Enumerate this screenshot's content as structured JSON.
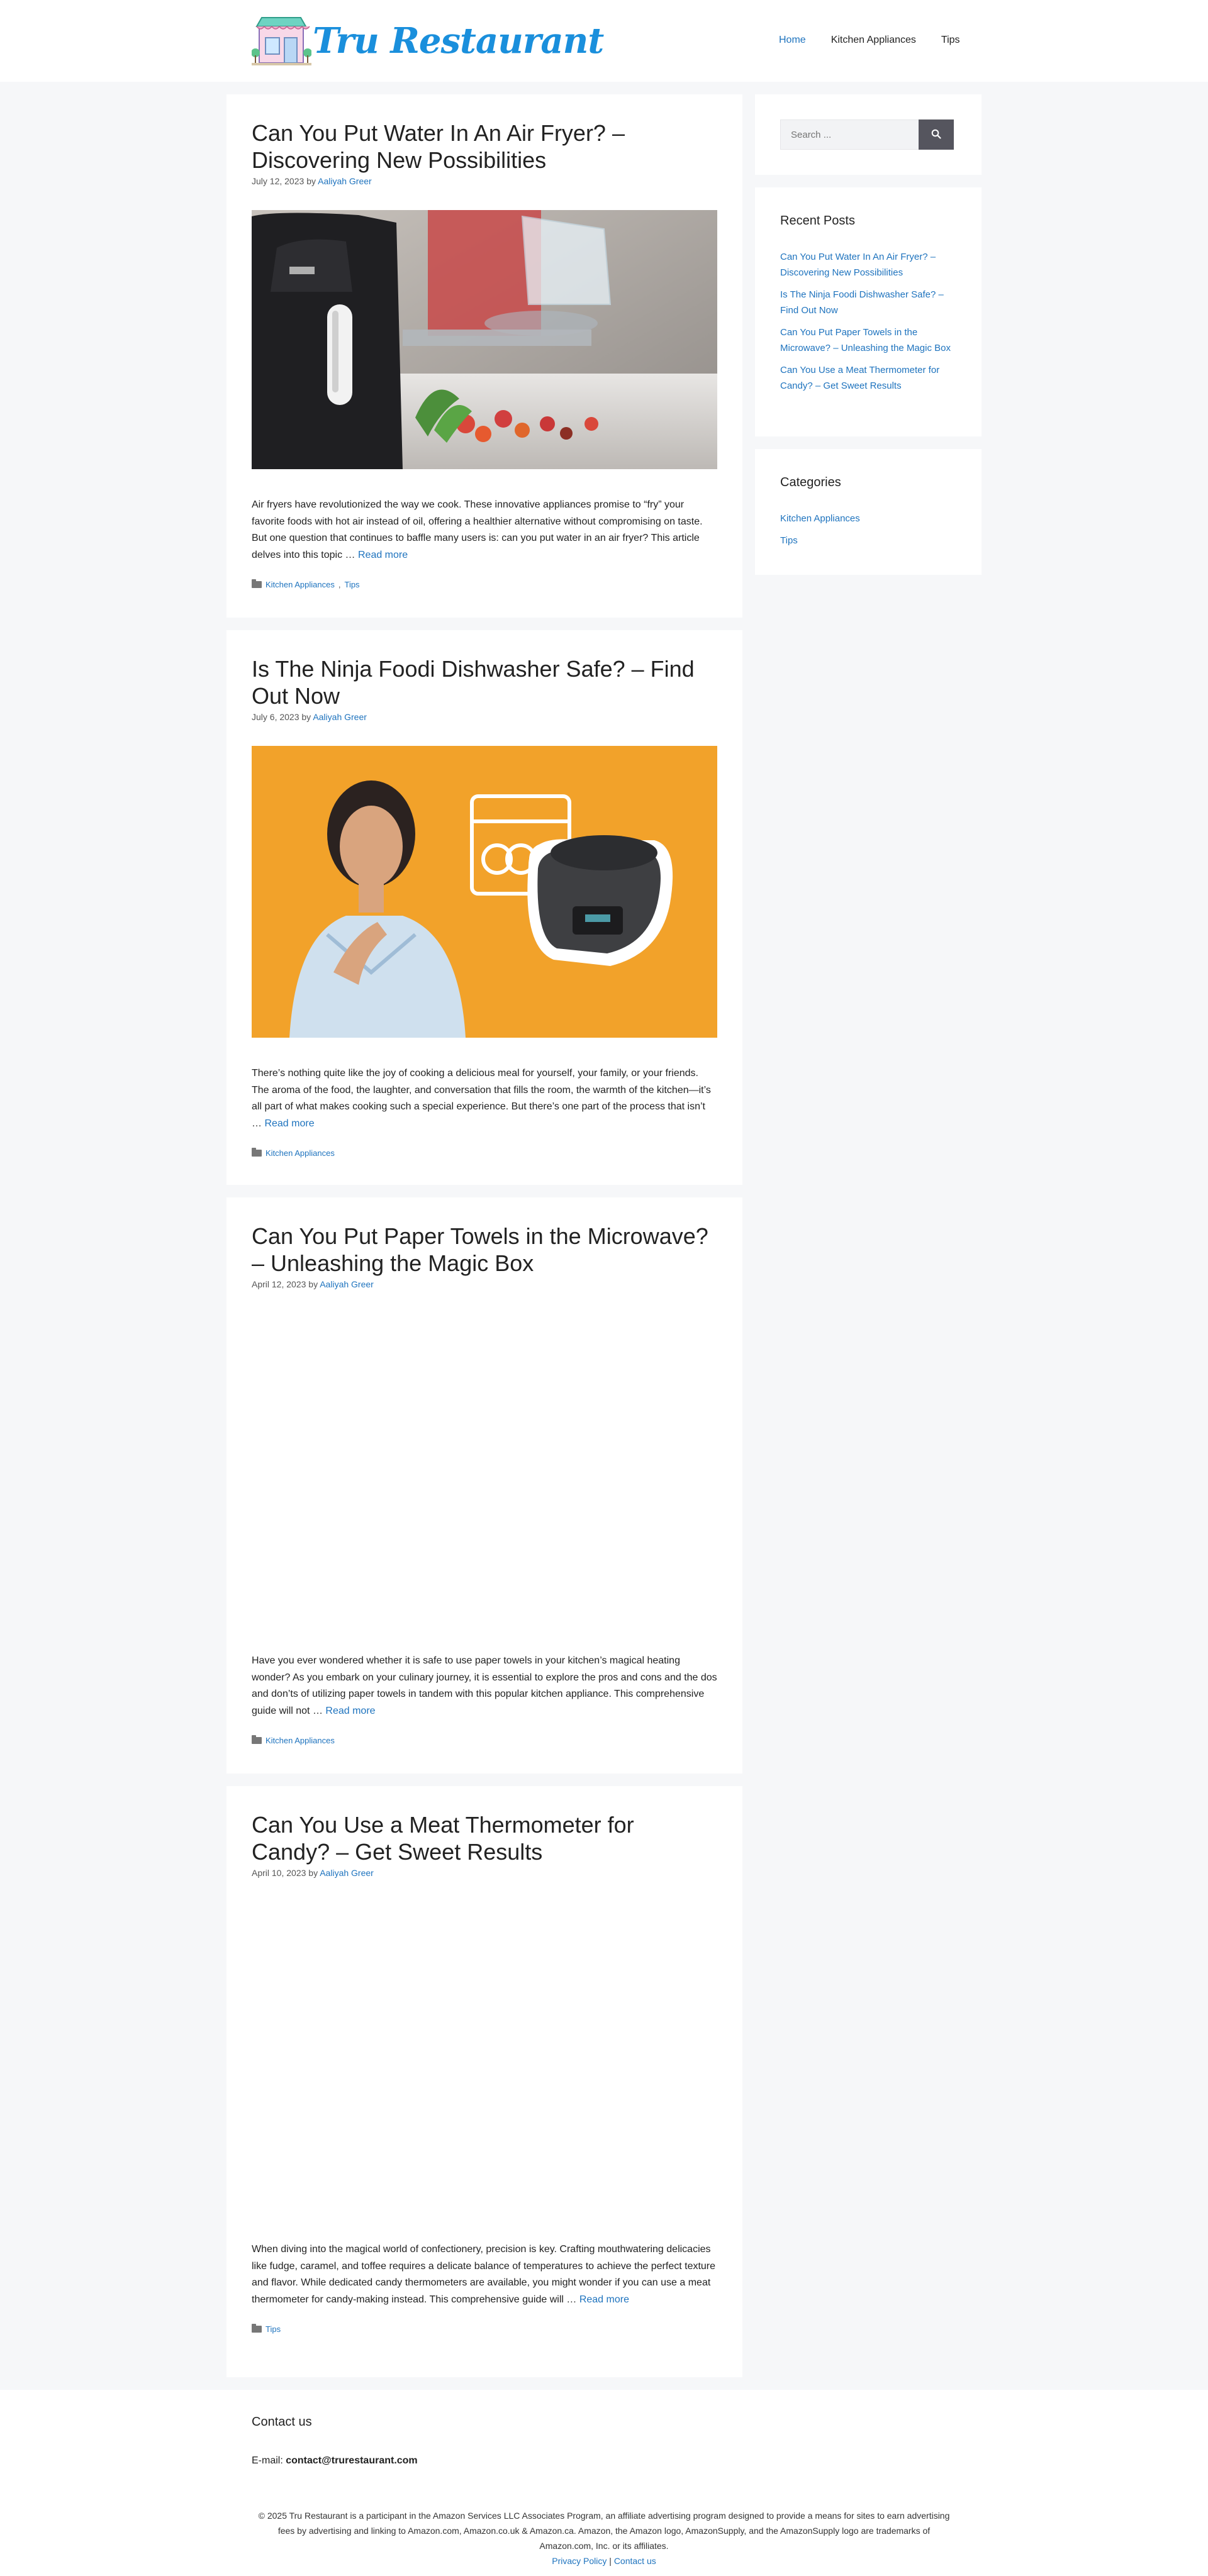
{
  "site": {
    "logo_text": "Tru Restaurant",
    "accent_color": "#1e73be",
    "nav": [
      "Home",
      "Kitchen Appliances",
      "Tips"
    ]
  },
  "posts": [
    {
      "title": "Can You Put Water In An Air Fryer? – Discovering New Possibilities",
      "date": "July 12, 2023",
      "by": "by",
      "author": "Aaliyah Greer",
      "excerpt": "Air fryers have revolutionized the way we cook. These innovative appliances promise to “fry” your favorite foods with hot air instead of oil, offering a healthier alternative without compromising on taste. But one question that continues to baffle many users is: can you put water in an air fryer? This article delves into this topic …",
      "read_more": "Read more",
      "categories": [
        "Kitchen Appliances",
        "Tips"
      ],
      "image": "air-fryer-photo"
    },
    {
      "title": "Is The Ninja Foodi Dishwasher Safe? – Find Out Now",
      "date": "July 6, 2023",
      "by": "by",
      "author": "Aaliyah Greer",
      "excerpt": "There’s nothing quite like the joy of cooking a delicious meal for yourself, your family, or your friends. The aroma of the food, the laughter, and conversation that fills the room, the warmth of the kitchen—it’s all part of what makes cooking such a special experience. But there’s one part of the process that isn’t …",
      "read_more": "Read more",
      "categories": [
        "Kitchen Appliances"
      ],
      "image": "ninja-foodi-photo"
    },
    {
      "title": "Can You Put Paper Towels in the Microwave? – Unleashing the Magic Box",
      "date": "April 12, 2023",
      "by": "by",
      "author": "Aaliyah Greer",
      "excerpt": "Have you ever wondered whether it is safe to use paper towels in your kitchen’s magical heating wonder? As you embark on your culinary journey, it is essential to explore the pros and cons and the dos and don’ts of utilizing paper towels in tandem with this popular kitchen appliance. This comprehensive guide will not …",
      "read_more": "Read more",
      "categories": [
        "Kitchen Appliances"
      ]
    },
    {
      "title": "Can You Use a Meat Thermometer for Candy? – Get Sweet Results",
      "date": "April 10, 2023",
      "by": "by",
      "author": "Aaliyah Greer",
      "excerpt": "When diving into the magical world of confectionery, precision is key. Crafting mouthwatering delicacies like fudge, caramel, and toffee requires a delicate balance of temperatures to achieve the perfect texture and flavor. While dedicated candy thermometers are available, you might wonder if you can use a meat thermometer for candy-making instead. This comprehensive guide will …",
      "read_more": "Read more",
      "categories": [
        "Tips"
      ]
    }
  ],
  "sidebar": {
    "search_placeholder": "Search ...",
    "recent_title": "Recent Posts",
    "recent": [
      "Can You Put Water In An Air Fryer? – Discovering New Possibilities",
      "Is The Ninja Foodi Dishwasher Safe? – Find Out Now",
      "Can You Put Paper Towels in the Microwave? – Unleashing the Magic Box",
      "Can You Use a Meat Thermometer for Candy? – Get Sweet Results"
    ],
    "categories_title": "Categories",
    "categories": [
      "Kitchen Appliances",
      "Tips"
    ]
  },
  "footer": {
    "contact_title": "Contact us",
    "email_label": "E-mail:",
    "email": "contact@trurestaurant.com",
    "copyright": "© 2025 Tru Restaurant is a participant in the Amazon Services LLC Associates Program, an affiliate advertising program designed to provide a means for sites to earn advertising fees by advertising and linking to Amazon.com, Amazon.co.uk & Amazon.ca. Amazon, the Amazon logo, AmazonSupply, and the AmazonSupply logo are trademarks of Amazon.com, Inc. or its affiliates.",
    "privacy": "Privacy Policy",
    "sep": "|",
    "contact_link": "Contact us"
  }
}
